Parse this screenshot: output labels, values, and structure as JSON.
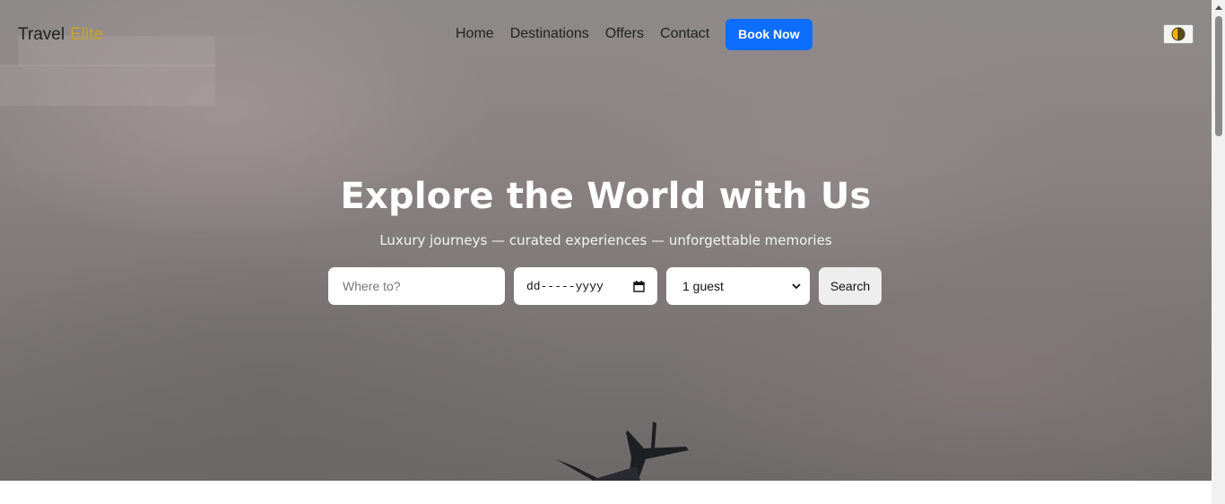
{
  "brand": {
    "name": "Travel",
    "accent": "Elite"
  },
  "nav": {
    "items": [
      "Home",
      "Destinations",
      "Offers",
      "Contact"
    ],
    "cta": "Book Now"
  },
  "hero": {
    "title": "Explore the World with Us",
    "subtitle": "Luxury journeys — curated experiences — unforgettable memories"
  },
  "search": {
    "where_placeholder": "Where to?",
    "date_placeholder": "dd-----yyyy",
    "guests_selected": "1 guest",
    "button": "Search"
  },
  "icons": {
    "theme_toggle": "half-moon-icon",
    "date": "calendar-icon",
    "select": "chevron-down-icon",
    "scroll_up": "triangle-up-icon"
  },
  "colors": {
    "brand_accent": "#c9a227",
    "primary_button": "#0d6efd"
  }
}
